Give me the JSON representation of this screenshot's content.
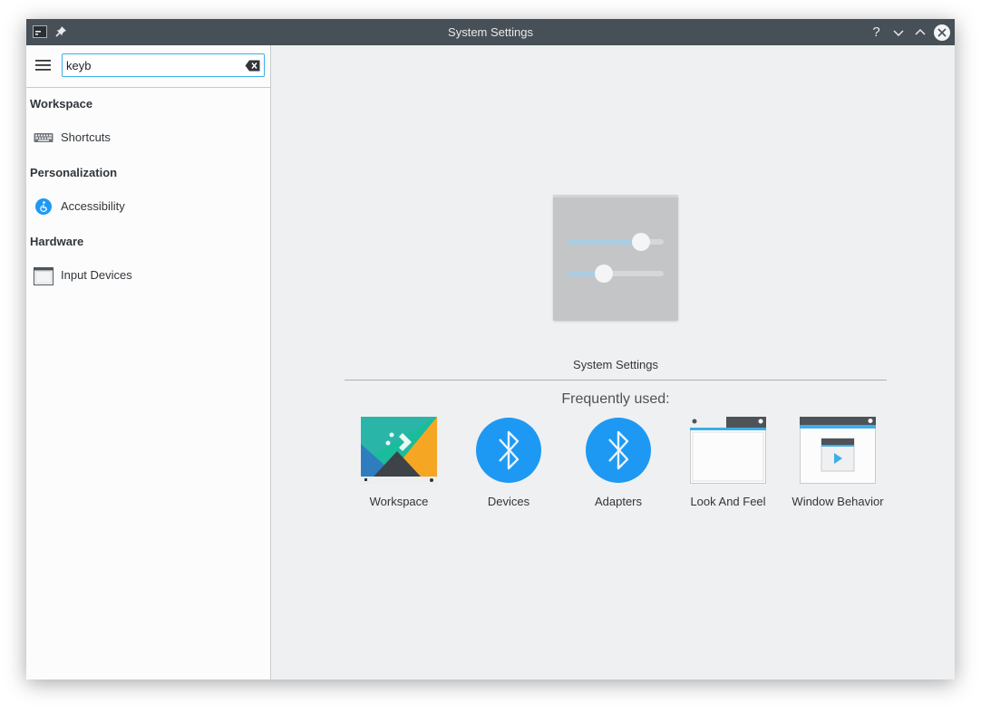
{
  "window": {
    "title": "System Settings",
    "help_glyph": "?"
  },
  "search": {
    "value": "keyb"
  },
  "sidebar": {
    "categories": [
      {
        "header": "Workspace",
        "items": [
          {
            "label": "Shortcuts",
            "icon": "keyboard-icon"
          }
        ]
      },
      {
        "header": "Personalization",
        "items": [
          {
            "label": "Accessibility",
            "icon": "accessibility-icon"
          }
        ]
      },
      {
        "header": "Hardware",
        "items": [
          {
            "label": "Input Devices",
            "icon": "input-devices-icon"
          }
        ]
      }
    ]
  },
  "main": {
    "hero_label": "System Settings",
    "frequently_used_label": "Frequently used:",
    "frequent_items": [
      {
        "label": "Workspace",
        "icon": "workspace-icon"
      },
      {
        "label": "Devices",
        "icon": "bluetooth-icon"
      },
      {
        "label": "Adapters",
        "icon": "bluetooth-icon"
      },
      {
        "label": "Look And Feel",
        "icon": "look-and-feel-icon"
      },
      {
        "label": "Window Behavior",
        "icon": "window-behavior-icon"
      }
    ]
  },
  "colors": {
    "titlebar": "#475057",
    "accent": "#3daee9",
    "bluetooth": "#1d99f3",
    "background": "#eff0f1"
  }
}
